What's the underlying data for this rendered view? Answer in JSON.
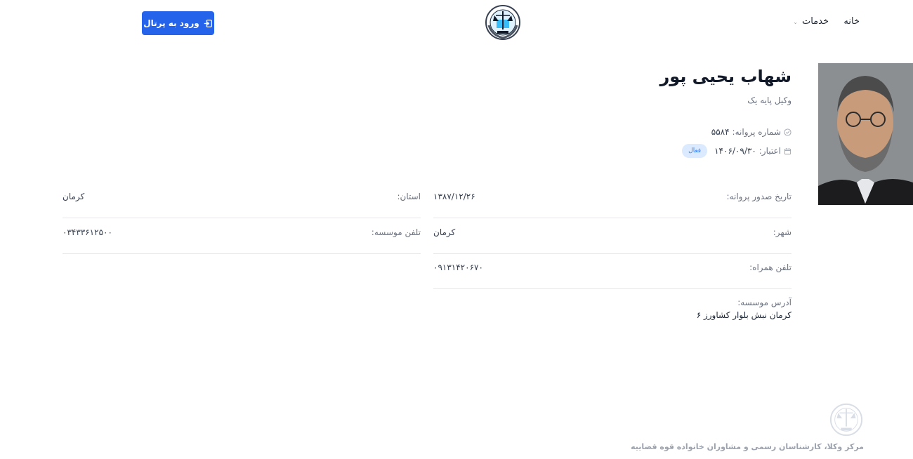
{
  "nav": {
    "home": "خانه",
    "services": "خدمات",
    "portal_button": "ورود به پرتال"
  },
  "profile": {
    "name": "شهاب یحیی پور",
    "rank": "وکیل پایه یک",
    "license_label": "شماره پروانه:",
    "license_value": "۵۵۸۴",
    "validity_label": "اعتبار:",
    "validity_value": "۱۴۰۶/۰۹/۳۰",
    "status": "فعال"
  },
  "details": {
    "issue_date_label": "تاریخ صدور پروانه:",
    "issue_date_value": "۱۳۸۷/۱۲/۲۶",
    "province_label": "استان:",
    "province_value": "کرمان",
    "city_label": "شهر:",
    "city_value": "کرمان",
    "office_phone_label": "تلفن موسسه:",
    "office_phone_value": "۰۳۴۳۳۶۱۲۵۰۰",
    "mobile_label": "تلفن همراه:",
    "mobile_value": "۰۹۱۳۱۴۲۰۶۷۰",
    "address_label": "آدرس موسسه:",
    "address_value": "کرمان نبش بلوار کشاورز ۶"
  },
  "footer": {
    "text": "مرکز وکلا، کارشناسان رسمی و مشاوران خانواده قوه قضاییه"
  },
  "icons": {
    "logo": "judiciary-emblem-icon",
    "portal": "login-icon",
    "license": "check-circle-icon",
    "validity": "calendar-icon",
    "services_chevron": "chevron-down-icon"
  },
  "colors": {
    "primary": "#2563eb",
    "badge_bg": "#dbeafe",
    "badge_text": "#3b82f6"
  }
}
